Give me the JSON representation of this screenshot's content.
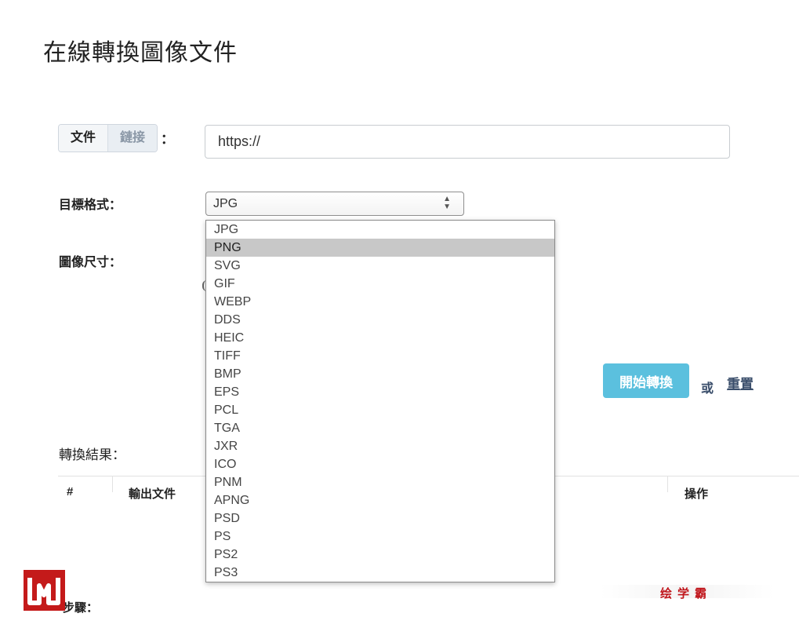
{
  "page": {
    "title": "在線轉換圖像文件"
  },
  "source": {
    "file_label": "文件",
    "link_label": "鏈接",
    "colon": "：",
    "url_value": "https://"
  },
  "format": {
    "label": "目標格式：",
    "selected": "JPG",
    "options": [
      "JPG",
      "PNG",
      "SVG",
      "GIF",
      "WEBP",
      "DDS",
      "HEIC",
      "TIFF",
      "BMP",
      "EPS",
      "PCL",
      "TGA",
      "JXR",
      "ICO",
      "PNM",
      "APNG",
      "PSD",
      "PS",
      "PS2",
      "PS3"
    ],
    "highlighted": "PNG"
  },
  "size": {
    "label": "圖像尺寸："
  },
  "actions": {
    "start_label": "開始轉換",
    "or_label": "或",
    "reset_label": "重置",
    "start_color": "#5bc0de"
  },
  "results": {
    "label": "轉換結果：",
    "columns": [
      "#",
      "輸出文件",
      "操作"
    ]
  },
  "footer": {
    "steps_label": "步驟：",
    "watermark_text": "绘学霸",
    "logo_color": "#c41a1a"
  }
}
